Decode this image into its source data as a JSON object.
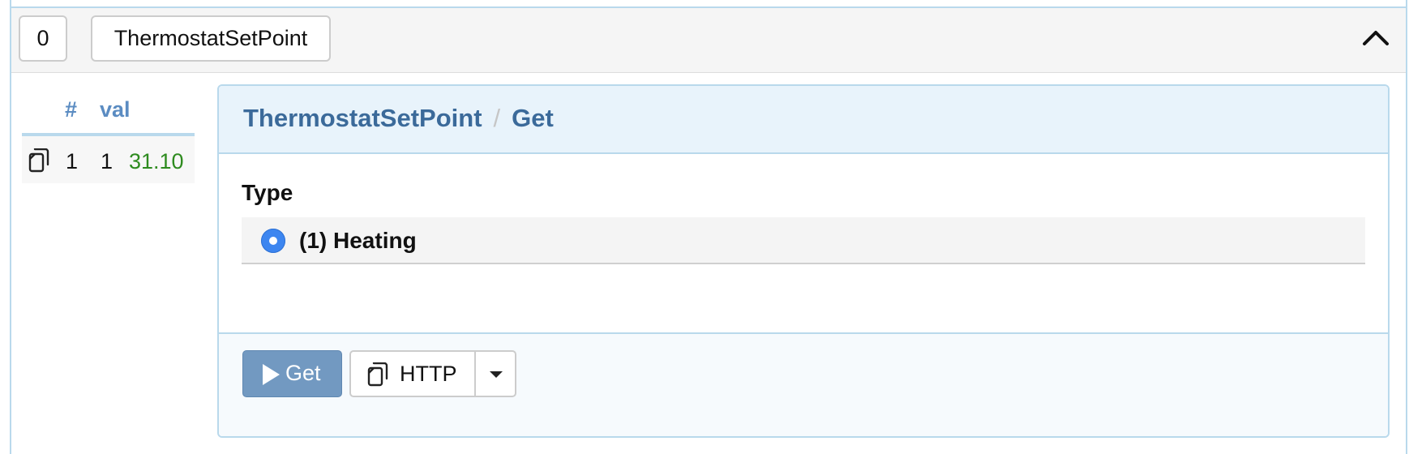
{
  "panel": {
    "index": "0",
    "name": "ThermostatSetPoint",
    "collapse_icon": "chevron-up-icon"
  },
  "results": {
    "headers": [
      "#",
      "val"
    ],
    "rows": [
      {
        "copy_icon": "copy-icon",
        "row_number": "1",
        "index": "1",
        "value": "31.10"
      }
    ],
    "value_color": "#2e8b1f"
  },
  "command": {
    "class_name": "ThermostatSetPoint",
    "separator": "/",
    "command_name": "Get",
    "field_label": "Type",
    "options": [
      {
        "label": "(1) Heating",
        "selected": true
      }
    ]
  },
  "actions": {
    "get_label": "Get",
    "get_icon": "play-icon",
    "http_label": "HTTP",
    "http_icon": "copy-icon",
    "dropdown_icon": "caret-down-icon"
  },
  "colors": {
    "accent_border": "#b9d9ec",
    "title_blue": "#3b6a9a",
    "button_primary": "#7299c1",
    "radio_selected": "#3d86f0"
  }
}
